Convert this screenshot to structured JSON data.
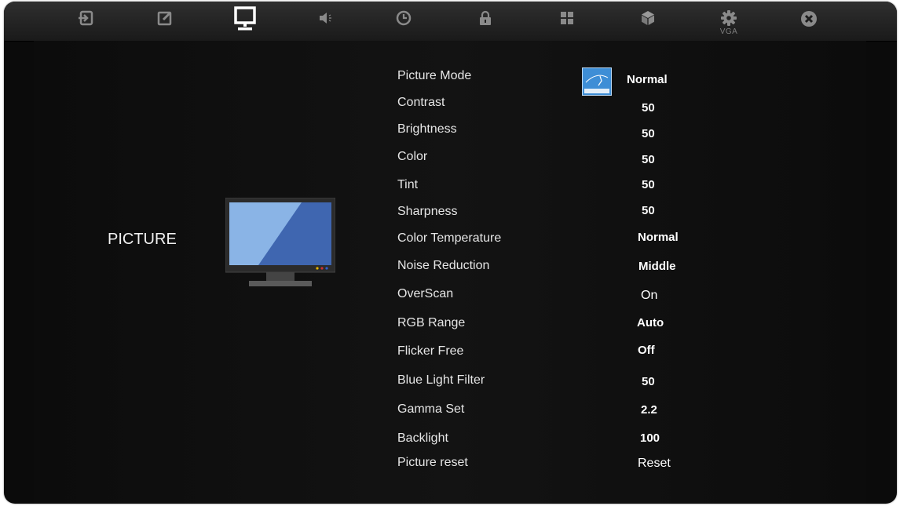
{
  "topbar": {
    "tabs": [
      {
        "icon": "input-icon"
      },
      {
        "icon": "edit-icon"
      },
      {
        "icon": "monitor-icon",
        "active": true
      },
      {
        "icon": "speaker-icon"
      },
      {
        "icon": "clock-icon"
      },
      {
        "icon": "lock-icon"
      },
      {
        "icon": "grid-icon"
      },
      {
        "icon": "cube-icon"
      },
      {
        "icon": "gear-icon",
        "sub": "VGA"
      },
      {
        "icon": "close-icon"
      }
    ],
    "vga_label": "VGA"
  },
  "section": {
    "title": "PICTURE"
  },
  "settings": [
    {
      "label": "Picture Mode",
      "value": "Normal"
    },
    {
      "label": "Contrast",
      "value": "50"
    },
    {
      "label": "Brightness",
      "value": "50"
    },
    {
      "label": "Color",
      "value": "50"
    },
    {
      "label": "Tint",
      "value": "50"
    },
    {
      "label": "Sharpness",
      "value": "50"
    },
    {
      "label": "Color Temperature",
      "value": "Normal"
    },
    {
      "label": "Noise Reduction",
      "value": "Middle"
    },
    {
      "label": "OverScan",
      "value": "On"
    },
    {
      "label": "RGB Range",
      "value": "Auto"
    },
    {
      "label": "Flicker Free",
      "value": "Off"
    },
    {
      "label": "Blue Light Filter",
      "value": "50"
    },
    {
      "label": "Gamma Set",
      "value": "2.2"
    },
    {
      "label": "Backlight",
      "value": "100"
    },
    {
      "label": "Picture reset",
      "value": "Reset"
    }
  ],
  "colors": {
    "background": "#0b0b0b",
    "screen_light": "#8ab4e6",
    "screen_dark": "#3f66b0",
    "energy_badge": "#3e8ed6"
  }
}
